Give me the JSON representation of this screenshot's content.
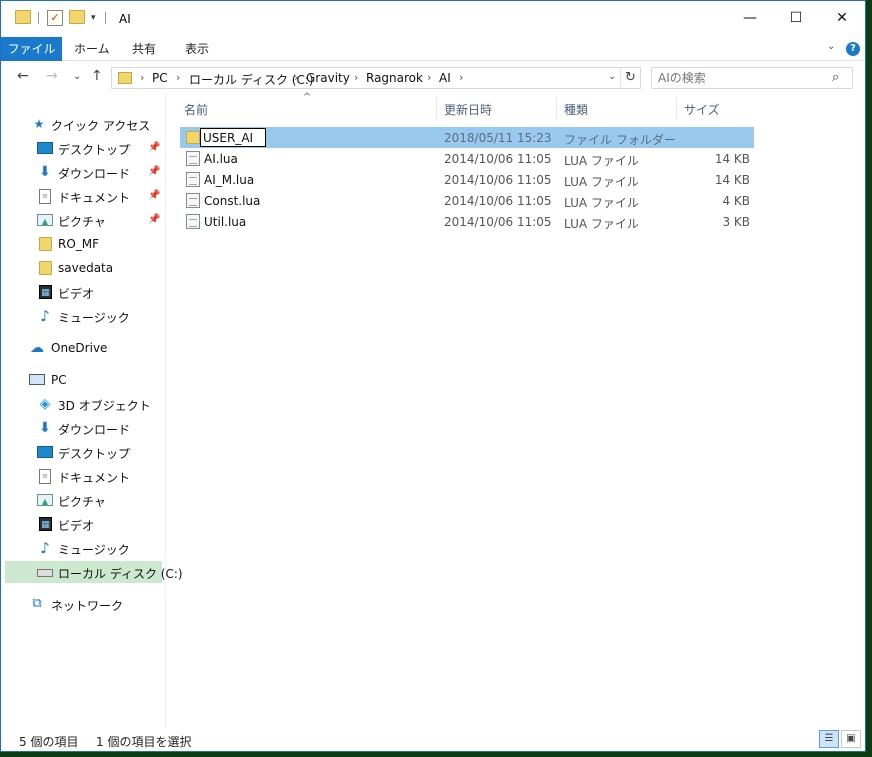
{
  "window": {
    "title": "AI",
    "controls": {
      "minimize": "—",
      "maximize": "☐",
      "close": "✕"
    }
  },
  "quick_access_toolbar": {
    "items": [
      "folder-icon",
      "properties-check-icon",
      "new-folder-icon",
      "customize-dropdown-icon"
    ],
    "check_glyph": "✓",
    "dropdown_glyph": "▾"
  },
  "ribbon": {
    "tabs": [
      "ファイル",
      "ホーム",
      "共有",
      "表示"
    ],
    "expand_glyph": "⌄",
    "help_glyph": "?"
  },
  "navigation": {
    "back_glyph": "←",
    "forward_glyph": "→",
    "recent_glyph": "⌄",
    "up_glyph": "↑",
    "breadcrumb": [
      "PC",
      "ローカル ディスク (C:)",
      "Gravity",
      "Ragnarok",
      "AI"
    ],
    "breadcrumb_sep": "›",
    "dropdown_glyph": "⌄",
    "refresh_glyph": "↻"
  },
  "search": {
    "placeholder": "AIの検索",
    "icon_glyph": "⌕"
  },
  "sidebar": {
    "quick_access": {
      "label": "クイック アクセス",
      "icon": "star-icon",
      "glyph": "★"
    },
    "pinned_glyph": "📌",
    "quick_items": [
      {
        "label": "デスクトップ",
        "icon": "desktop-icon",
        "pinned": true
      },
      {
        "label": "ダウンロード",
        "icon": "download-icon",
        "pinned": true,
        "glyph": "⬇"
      },
      {
        "label": "ドキュメント",
        "icon": "document-icon",
        "pinned": true,
        "glyph": "≡"
      },
      {
        "label": "ピクチャ",
        "icon": "pictures-icon",
        "pinned": true,
        "glyph": "▲"
      },
      {
        "label": "RO_MF",
        "icon": "folder-icon",
        "pinned": false
      },
      {
        "label": "savedata",
        "icon": "folder-icon",
        "pinned": false
      },
      {
        "label": "ビデオ",
        "icon": "video-icon",
        "pinned": false,
        "glyph": "▦"
      },
      {
        "label": "ミュージック",
        "icon": "music-icon",
        "pinned": false,
        "glyph": "♪"
      }
    ],
    "onedrive": {
      "label": "OneDrive",
      "icon": "cloud-icon",
      "glyph": "☁"
    },
    "pc": {
      "label": "PC",
      "icon": "pc-icon"
    },
    "pc_items": [
      {
        "label": "3D オブジェクト",
        "icon": "3d-objects-icon",
        "glyph": "◈"
      },
      {
        "label": "ダウンロード",
        "icon": "download-icon",
        "glyph": "⬇"
      },
      {
        "label": "デスクトップ",
        "icon": "desktop-icon"
      },
      {
        "label": "ドキュメント",
        "icon": "document-icon",
        "glyph": "≡"
      },
      {
        "label": "ピクチャ",
        "icon": "pictures-icon",
        "glyph": "▲"
      },
      {
        "label": "ビデオ",
        "icon": "video-icon",
        "glyph": "▦"
      },
      {
        "label": "ミュージック",
        "icon": "music-icon",
        "glyph": "♪"
      },
      {
        "label": "ローカル ディスク (C:)",
        "icon": "drive-icon",
        "selected": true
      }
    ],
    "network": {
      "label": "ネットワーク",
      "icon": "network-icon",
      "glyph": "⧉"
    }
  },
  "file_list": {
    "sort_glyph": "^",
    "columns": {
      "name": "名前",
      "date": "更新日時",
      "type": "種類",
      "size": "サイズ"
    },
    "rows": [
      {
        "name": "USER_AI",
        "date": "2018/05/11 15:23",
        "type": "ファイル フォルダー",
        "size": "",
        "icon": "folder-icon",
        "selected": true,
        "renaming": true
      },
      {
        "name": "AI.lua",
        "date": "2014/10/06 11:05",
        "type": "LUA ファイル",
        "size": "14 KB",
        "icon": "lua-file-icon"
      },
      {
        "name": "AI_M.lua",
        "date": "2014/10/06 11:05",
        "type": "LUA ファイル",
        "size": "14 KB",
        "icon": "lua-file-icon"
      },
      {
        "name": "Const.lua",
        "date": "2014/10/06 11:05",
        "type": "LUA ファイル",
        "size": "4 KB",
        "icon": "lua-file-icon"
      },
      {
        "name": "Util.lua",
        "date": "2014/10/06 11:05",
        "type": "LUA ファイル",
        "size": "3 KB",
        "icon": "lua-file-icon"
      }
    ]
  },
  "status_bar": {
    "item_count": "5 個の項目",
    "selection": "1 個の項目を選択",
    "details_view_glyph": "☰",
    "large_icons_view_glyph": "▣"
  },
  "colors": {
    "accent": "#1979ca",
    "selection": "#99c9ef",
    "sidebar_selected": "#cce8cf",
    "desktop_background": "#0b3d10"
  }
}
